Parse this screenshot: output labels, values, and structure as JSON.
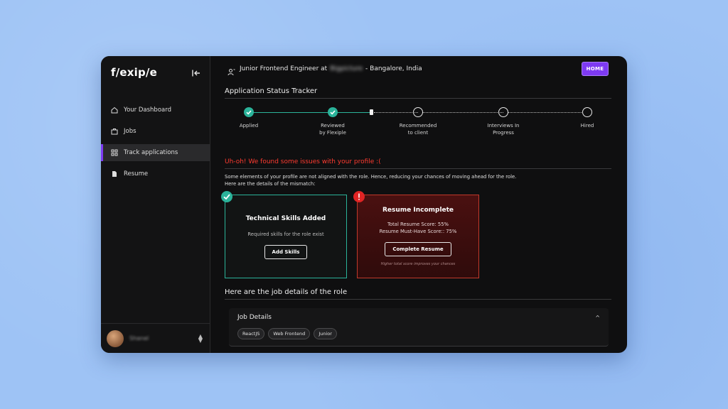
{
  "sidebar": {
    "logo": "f/exip/e",
    "items": [
      {
        "label": "Your Dashboard",
        "icon": "home-icon"
      },
      {
        "label": "Jobs",
        "icon": "briefcase-icon"
      },
      {
        "label": "Track applications",
        "icon": "grid-icon",
        "active": true
      },
      {
        "label": "Resume",
        "icon": "document-icon"
      }
    ],
    "user": {
      "name": "Shanel"
    }
  },
  "header": {
    "job_prefix": "Junior Frontend Engineer at",
    "company": "Bigpicture",
    "job_suffix": "- Bangalore, India",
    "home_label": "HOME"
  },
  "tracker": {
    "title": "Application Status Tracker",
    "steps": [
      {
        "label": "Applied",
        "status": "done"
      },
      {
        "label": "Reviewed by Flexiple",
        "status": "done"
      },
      {
        "label": "Recommended to client",
        "status": "todo"
      },
      {
        "label": "Interviews In Progress",
        "status": "todo"
      },
      {
        "label": "Hired",
        "status": "todo"
      }
    ]
  },
  "issues": {
    "title": "Uh-oh! We found some issues with your profile :(",
    "description_line1": "Some elements of your profile are not aligned with the role. Hence, reducing your chances of moving ahead for the role.",
    "description_line2": "Here are the details of the mismatch:"
  },
  "cards": {
    "skills": {
      "title": "Technical Skills Added",
      "subtitle": "Required skills for the role exist",
      "button": "Add Skills"
    },
    "resume": {
      "title": "Resume Incomplete",
      "score_line": "Total Resume Score: 55%",
      "must_have_line": "Resume Must-Have Score:: 75%",
      "button": "Complete Resume",
      "note": "Higher total score improves your chances"
    }
  },
  "job": {
    "section_title": "Here are the job details of the role",
    "panel_title": "Job Details",
    "tags": [
      "ReactJS",
      "Web Frontend",
      "Junior"
    ]
  },
  "colors": {
    "accent": "#7e3af2",
    "success": "#2bb39a",
    "error": "#ff3b30",
    "background": "#9ec3f5",
    "panel": "#0f0f10"
  }
}
